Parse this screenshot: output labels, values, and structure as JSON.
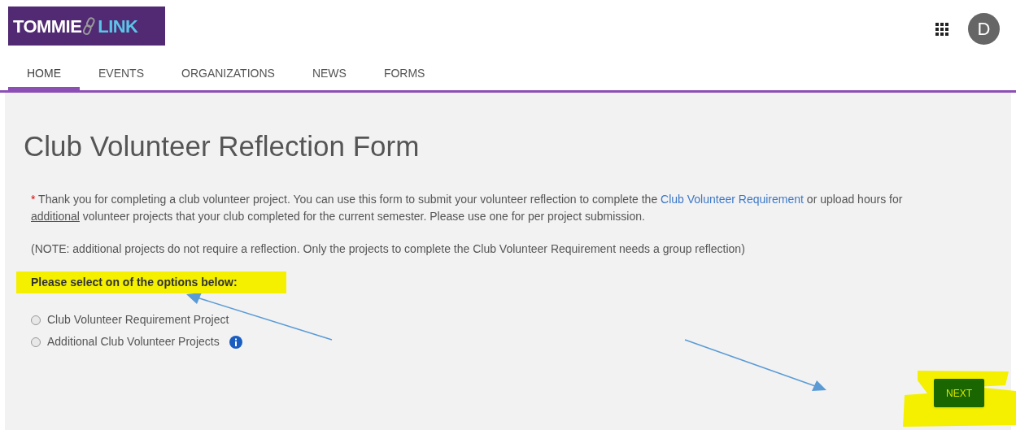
{
  "logo": {
    "left": "TOMMIE",
    "right": "LINK"
  },
  "avatar": {
    "initial": "D"
  },
  "nav": [
    {
      "label": "HOME",
      "selected": true
    },
    {
      "label": "EVENTS",
      "selected": false
    },
    {
      "label": "ORGANIZATIONS",
      "selected": false
    },
    {
      "label": "NEWS",
      "selected": false
    },
    {
      "label": "FORMS",
      "selected": false
    }
  ],
  "form": {
    "title": "Club Volunteer Reflection Form",
    "required_mark": "*",
    "intro": [
      {
        "kind": "text",
        "text": "Thank you for completing a club volunteer project. You can use this form to submit your volunteer reflection to complete the "
      },
      {
        "kind": "link",
        "text": "Club Volunteer Requirement"
      },
      {
        "kind": "text",
        "text": " or upload hours for "
      },
      {
        "kind": "underline",
        "text": "additional"
      },
      {
        "kind": "text",
        "text": " volunteer projects that your club completed for the current semester. Please use one for per project submission."
      }
    ],
    "note": "(NOTE: additional projects do not require a reflection. Only the projects to complete the Club Volunteer Requirement needs a group reflection)",
    "question": "Please select on of the options below:",
    "options": [
      {
        "label": "Club Volunteer Requirement Project",
        "selected": false,
        "info": false
      },
      {
        "label": "Additional Club Volunteer Projects",
        "selected": false,
        "info": true
      }
    ],
    "next_button": "NEXT"
  }
}
